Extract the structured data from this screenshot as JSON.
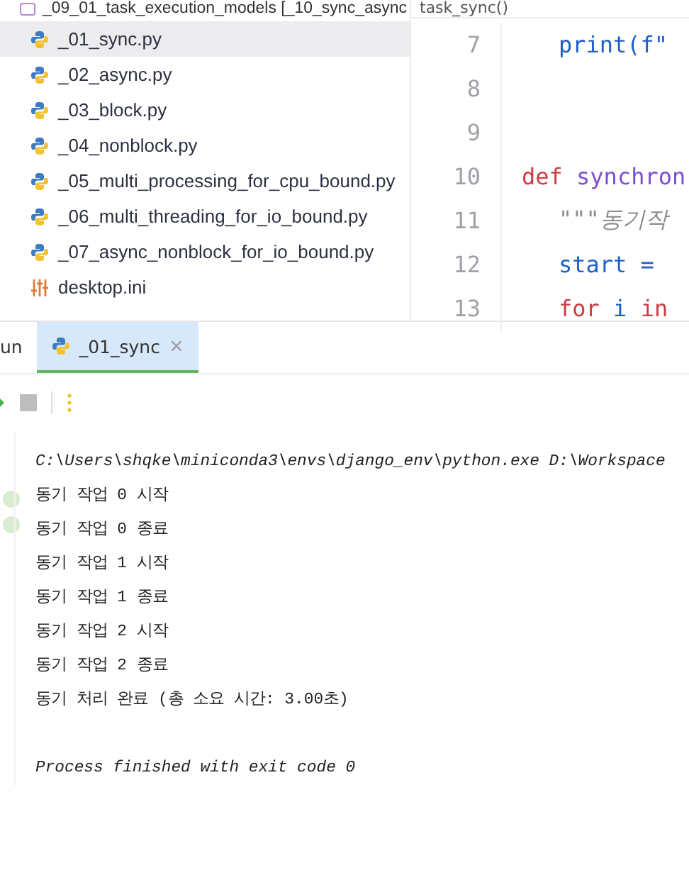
{
  "project_header": {
    "title": "_09_01_task_execution_models [_10_sync_async"
  },
  "breadcrumb": "task_sync()",
  "files": [
    {
      "name": "_01_sync.py",
      "kind": "python",
      "selected": true
    },
    {
      "name": "_02_async.py",
      "kind": "python",
      "selected": false
    },
    {
      "name": "_03_block.py",
      "kind": "python",
      "selected": false
    },
    {
      "name": "_04_nonblock.py",
      "kind": "python",
      "selected": false
    },
    {
      "name": "_05_multi_processing_for_cpu_bound.py",
      "kind": "python",
      "selected": false
    },
    {
      "name": "_06_multi_threading_for_io_bound.py",
      "kind": "python",
      "selected": false
    },
    {
      "name": "_07_async_nonblock_for_io_bound.py",
      "kind": "python",
      "selected": false
    },
    {
      "name": "desktop.ini",
      "kind": "config",
      "selected": false
    }
  ],
  "code_lines": [
    {
      "number": "7",
      "indent": true,
      "tokens": [
        {
          "text": "print(f\"",
          "kind": "plain"
        }
      ]
    },
    {
      "number": "8"
    },
    {
      "number": "9"
    },
    {
      "number": "10",
      "indent": false,
      "tokens": [
        {
          "text": "def",
          "kind": "keyword"
        },
        {
          "text": " synchron",
          "kind": "function"
        }
      ]
    },
    {
      "number": "11",
      "indent": true,
      "tokens": [
        {
          "text": "\"\"\"동기작",
          "kind": "docstring"
        }
      ]
    },
    {
      "number": "12",
      "indent": true,
      "tokens": [
        {
          "text": "start =",
          "kind": "plain"
        }
      ]
    },
    {
      "number": "13",
      "indent": true,
      "tokens": [
        {
          "text": "for",
          "kind": "keyword"
        },
        {
          "text": " i ",
          "kind": "plain"
        },
        {
          "text": "in",
          "kind": "keyword"
        }
      ]
    }
  ],
  "run_panel": {
    "tabs": [
      {
        "label": "un",
        "closable": false,
        "selected": false
      },
      {
        "label": "_01_sync",
        "closable": true,
        "selected": true
      }
    ],
    "close_glyph": "×"
  },
  "console": [
    {
      "text": "C:\\Users\\shqke\\miniconda3\\envs\\django_env\\python.exe D:\\Workspace",
      "kind": "command"
    },
    {
      "text": "동기 작업 0 시작",
      "kind": "output"
    },
    {
      "text": "동기 작업 0 종료",
      "kind": "output"
    },
    {
      "text": "동기 작업 1 시작",
      "kind": "output"
    },
    {
      "text": "동기 작업 1 종료",
      "kind": "output"
    },
    {
      "text": "동기 작업 2 시작",
      "kind": "output"
    },
    {
      "text": "동기 작업 2 종료",
      "kind": "output"
    },
    {
      "text": "동기 처리 완료 (총 소요 시간: 3.00초)",
      "kind": "output"
    },
    {
      "text": "Process finished with exit code 0",
      "kind": "exit"
    }
  ]
}
